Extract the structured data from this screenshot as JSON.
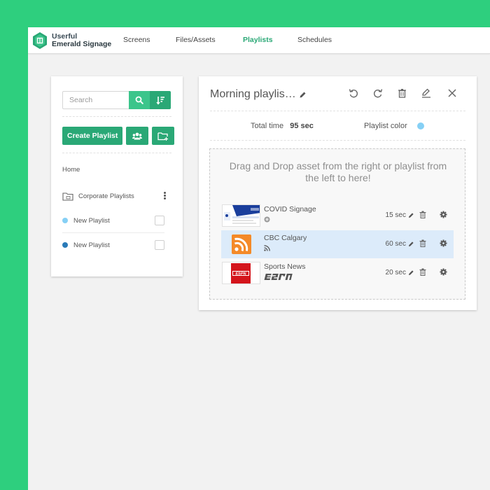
{
  "brand": {
    "line1": "Userful",
    "line2": "Emerald Signage"
  },
  "nav": {
    "items": [
      {
        "label": "Screens"
      },
      {
        "label": "Files/Assets"
      },
      {
        "label": "Playlists",
        "active": true
      },
      {
        "label": "Schedules"
      }
    ]
  },
  "sidebar": {
    "search_placeholder": "Search",
    "create_label": "Create Playlist",
    "breadcrumb": "Home",
    "folder_label": "Corporate Playlists",
    "playlists": [
      {
        "label": "New Playlist",
        "color": "#86d0f5"
      },
      {
        "label": "New Playlist",
        "color": "#2a7ab8"
      }
    ]
  },
  "editor": {
    "title": "Morning playlis…",
    "total_time_label": "Total time",
    "total_time_value": "95 sec",
    "color_label": "Playlist color",
    "color": "#86d0f5",
    "dropzone_text": "Drag and Drop asset from the right or playlist from the left to here!",
    "assets": [
      {
        "name": "COVID Signage",
        "duration": "15 sec",
        "type_icon": "web-icon",
        "thumb": "covid-webpage-thumbnail",
        "selected": false
      },
      {
        "name": "CBC Calgary",
        "duration": "60 sec",
        "type_icon": "rss-icon",
        "thumb": "rss-feed-thumbnail",
        "selected": true
      },
      {
        "name": "Sports News",
        "duration": "20 sec",
        "type_icon": "espn-logo-icon",
        "thumb": "espn-thumbnail",
        "selected": false
      }
    ]
  },
  "colors": {
    "accent": "#2aa876",
    "accent_light": "#3cc58b",
    "background": "#2ecf7e",
    "selected_row": "#dcebfa"
  }
}
